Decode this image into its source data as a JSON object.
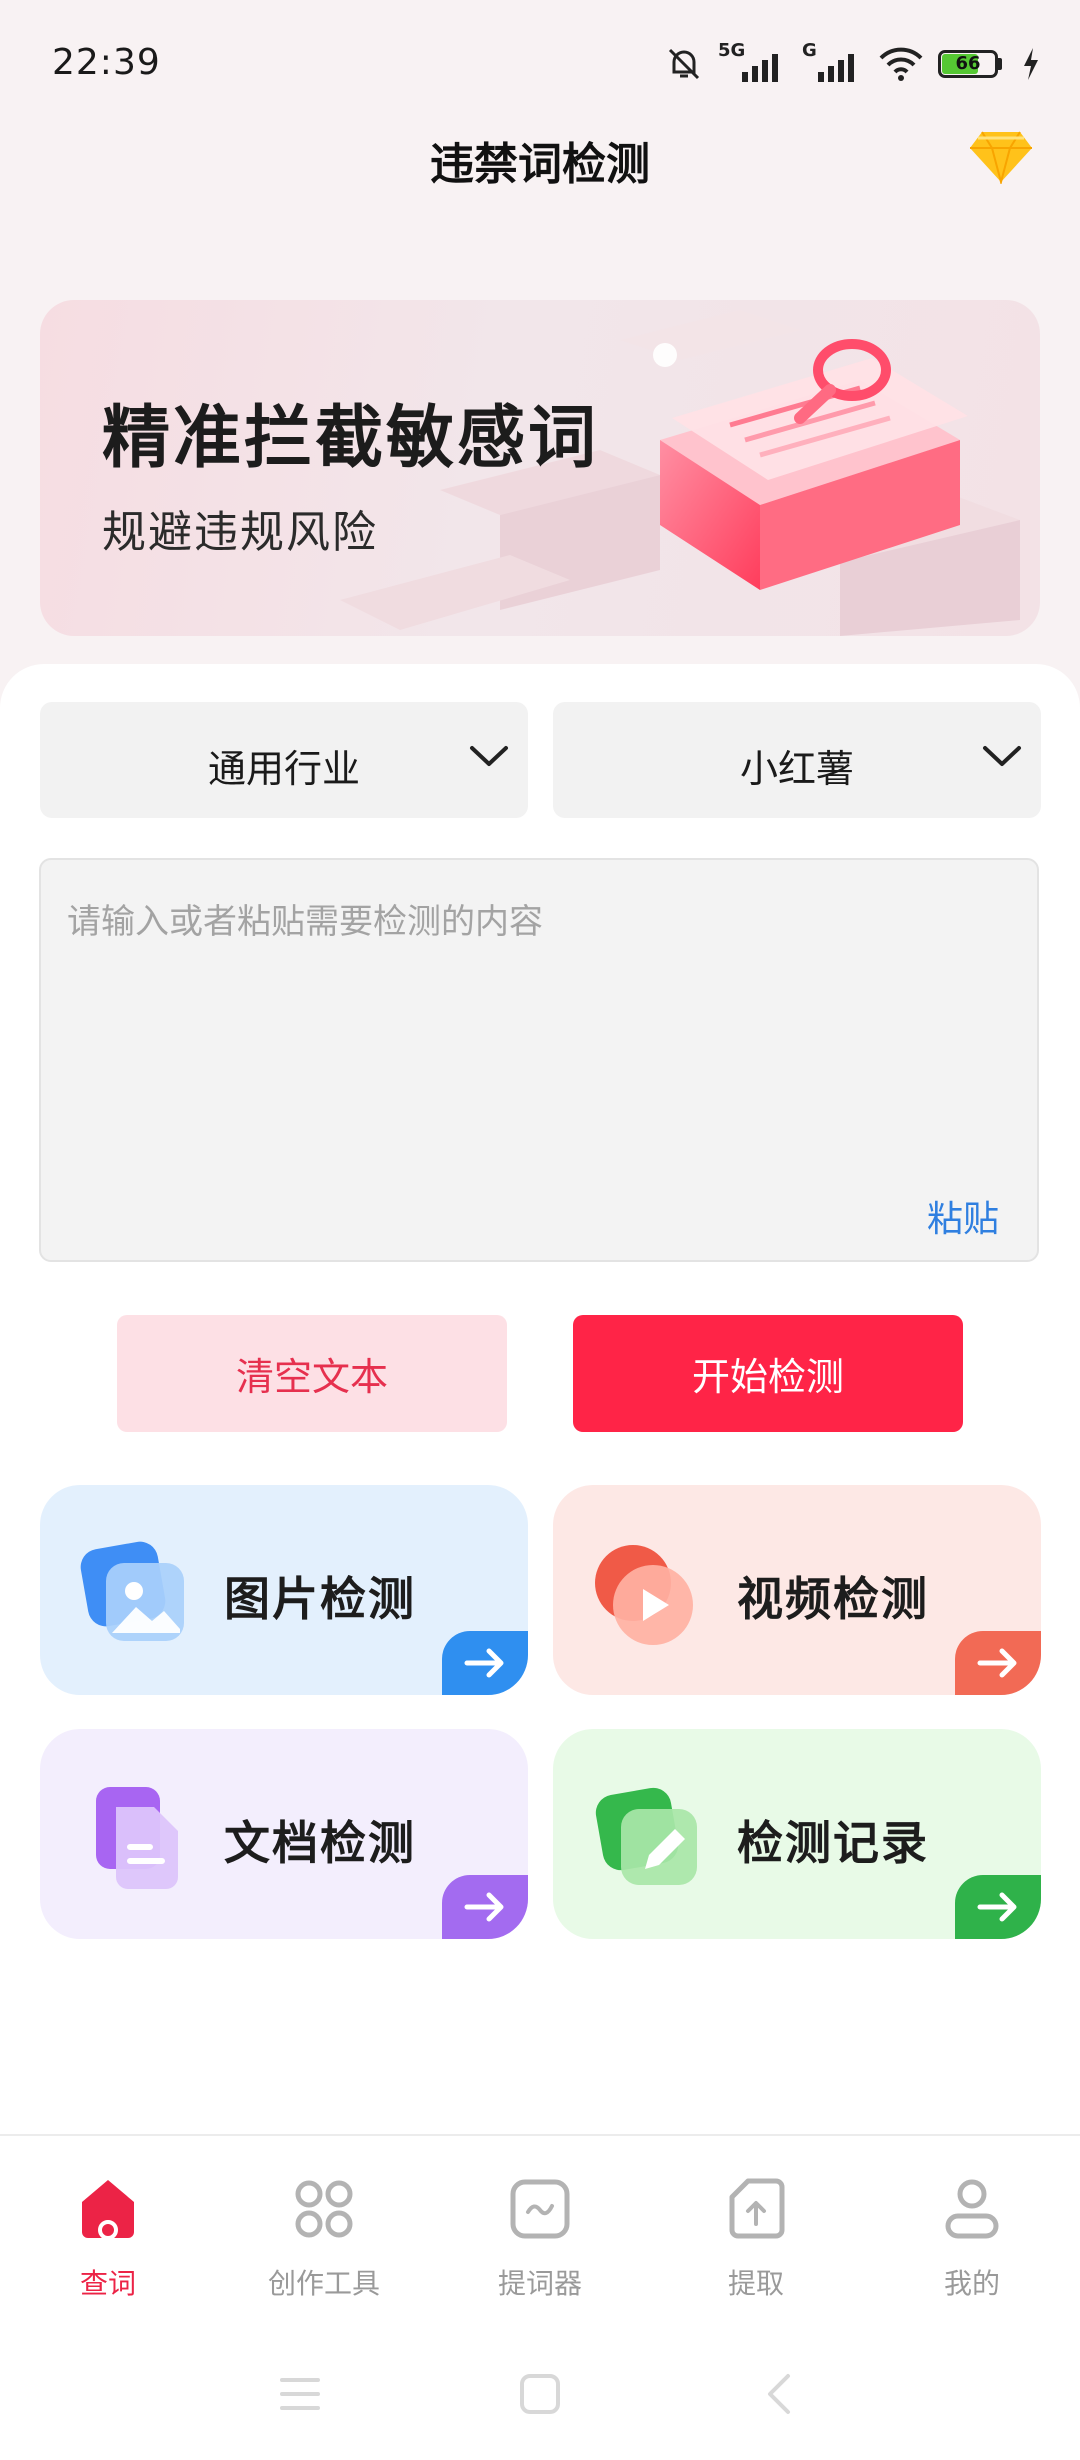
{
  "status_bar": {
    "time": "22:39",
    "network_1": "5G",
    "network_2": "G",
    "battery": "66",
    "icons": [
      "mute-bell-icon",
      "signal-icon",
      "signal-icon",
      "wifi-icon",
      "battery-icon",
      "charging-icon"
    ]
  },
  "header": {
    "title": "违禁词检测",
    "vip_icon": "diamond-icon"
  },
  "banner": {
    "title": "精准拦截敏感词",
    "subtitle": "规避违规风险"
  },
  "filters": {
    "industry": "通用行业",
    "platform": "小红薯"
  },
  "input": {
    "placeholder": "请输入或者粘贴需要检测的内容",
    "paste_label": "粘贴"
  },
  "actions": {
    "clear_label": "清空文本",
    "start_label": "开始检测"
  },
  "features": [
    {
      "label": "图片检测",
      "icon": "image-icon",
      "accent": "#2f8ff0"
    },
    {
      "label": "视频检测",
      "icon": "video-play-icon",
      "accent": "#f26a55"
    },
    {
      "label": "文档检测",
      "icon": "document-icon",
      "accent": "#a36bf0"
    },
    {
      "label": "检测记录",
      "icon": "edit-record-icon",
      "accent": "#2fb24a"
    }
  ],
  "nav": [
    {
      "label": "查词",
      "icon": "home-icon",
      "active": true
    },
    {
      "label": "创作工具",
      "icon": "grid-icon",
      "active": false
    },
    {
      "label": "提词器",
      "icon": "prompter-icon",
      "active": false
    },
    {
      "label": "提取",
      "icon": "extract-file-icon",
      "active": false
    },
    {
      "label": "我的",
      "icon": "user-icon",
      "active": false
    }
  ],
  "colors": {
    "brand": "#ff2447",
    "brand_light": "#fde0e5",
    "link": "#2f7fe0",
    "nav_active": "#ec2346",
    "nav_inactive": "#9a9a9a"
  }
}
